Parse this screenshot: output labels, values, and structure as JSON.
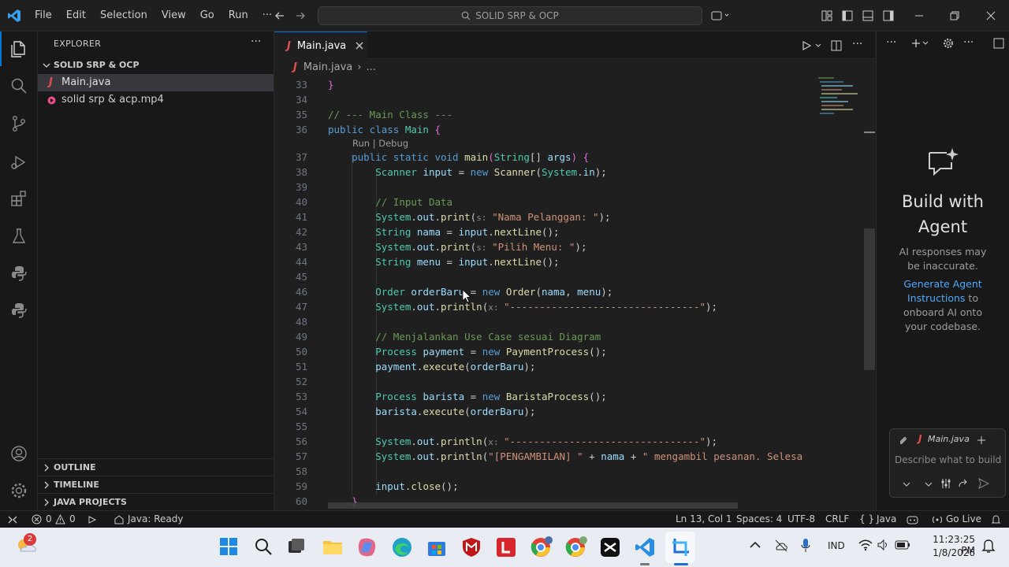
{
  "titlebar": {
    "menu": [
      "File",
      "Edit",
      "Selection",
      "View",
      "Go",
      "Run",
      "···"
    ],
    "search_text": "SOLID SRP & OCP"
  },
  "sidebar": {
    "header": "EXPLORER",
    "folder": "SOLID SRP & OCP",
    "files": [
      {
        "name": "Main.java",
        "icon": "java-file-icon"
      },
      {
        "name": "solid  srp & acp.mp4",
        "icon": "media-file-icon"
      }
    ],
    "sections": [
      "OUTLINE",
      "TIMELINE",
      "JAVA PROJECTS"
    ]
  },
  "editor": {
    "tab_label": "Main.java",
    "breadcrumb_file": "Main.java",
    "breadcrumb_more": "...",
    "codelens": "Run | Debug",
    "lines": [
      "33",
      "34",
      "35",
      "36",
      "37",
      "38",
      "39",
      "40",
      "41",
      "42",
      "43",
      "44",
      "45",
      "46",
      "47",
      "48",
      "49",
      "50",
      "51",
      "52",
      "53",
      "54",
      "55",
      "56",
      "57",
      "58",
      "59",
      "60"
    ]
  },
  "chat": {
    "title": "Build with Agent",
    "note": "AI responses may be inaccurate.",
    "link": "Generate Agent Instructions",
    "rest": "to onboard AI onto your codebase.",
    "context_file": "Main.java",
    "placeholder": "Describe what to build"
  },
  "statusbar": {
    "errors": "0",
    "warnings": "0",
    "java_status": "Java: Ready",
    "position": "Ln 13, Col 1",
    "spaces": "Spaces: 4",
    "encoding": "UTF-8",
    "eol": "CRLF",
    "language": "Java",
    "golive": "Go Live"
  },
  "taskbar": {
    "badge": "2",
    "lang": "IND",
    "time": "11:23:25 PM",
    "date": "1/8/2026"
  },
  "colors": {
    "accent": "#0078d4",
    "java_icon": "#e84d4d",
    "link": "#4daafc"
  }
}
